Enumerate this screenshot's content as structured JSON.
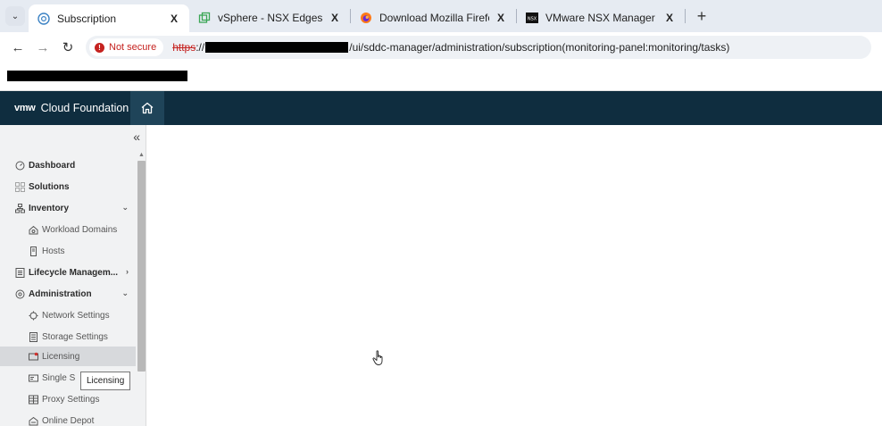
{
  "browser": {
    "tabs": [
      {
        "title": "Subscription",
        "icon": "vcf-icon",
        "active": true
      },
      {
        "title": "vSphere - NSX Edges",
        "icon": "vsphere-icon",
        "active": false
      },
      {
        "title": "Download Mozilla Firefox for W",
        "icon": "firefox-icon",
        "active": false
      },
      {
        "title": "VMware NSX Manager Virtual A",
        "icon": "nsx-icon",
        "active": false
      }
    ],
    "close_glyph": "X",
    "new_tab_glyph": "+",
    "menu_glyph": "⌄",
    "security_label": "Not secure",
    "url_scheme": "https",
    "url_sep": "://",
    "url_path": "/ui/sddc-manager/administration/subscription(monitoring-panel:monitoring/tasks)"
  },
  "app": {
    "brand_logo": "vmw",
    "brand_name": "Cloud Foundation"
  },
  "sidebar": {
    "collapse_glyph": "«",
    "items": [
      {
        "label": "Dashboard",
        "icon": "dashboard-icon",
        "level": "top"
      },
      {
        "label": "Solutions",
        "icon": "solutions-icon",
        "level": "top"
      },
      {
        "label": "Inventory",
        "icon": "inventory-icon",
        "level": "top",
        "chevron": "⌄"
      },
      {
        "label": "Workload Domains",
        "icon": "workload-domains-icon",
        "level": "sub"
      },
      {
        "label": "Hosts",
        "icon": "hosts-icon",
        "level": "sub"
      },
      {
        "label": "Lifecycle Managem...",
        "icon": "lifecycle-icon",
        "level": "top",
        "chevron": "›"
      },
      {
        "label": "Administration",
        "icon": "administration-icon",
        "level": "top",
        "chevron": "⌄"
      },
      {
        "label": "Network Settings",
        "icon": "network-settings-icon",
        "level": "sub"
      },
      {
        "label": "Storage Settings",
        "icon": "storage-settings-icon",
        "level": "sub"
      },
      {
        "label": "Licensing",
        "icon": "licensing-icon",
        "level": "sub",
        "selected": true
      },
      {
        "label": "Single S",
        "icon": "single-sign-on-icon",
        "level": "sub"
      },
      {
        "label": "Proxy Settings",
        "icon": "proxy-settings-icon",
        "level": "sub"
      },
      {
        "label": "Online Depot",
        "icon": "online-depot-icon",
        "level": "sub"
      }
    ],
    "tooltip": "Licensing"
  },
  "colors": {
    "header_bg": "#0f2d3f",
    "home_bg": "#1f4459",
    "sidebar_bg": "#f1f2f3",
    "selected_bg": "#d7d9dc",
    "insecure_red": "#c5221f"
  }
}
